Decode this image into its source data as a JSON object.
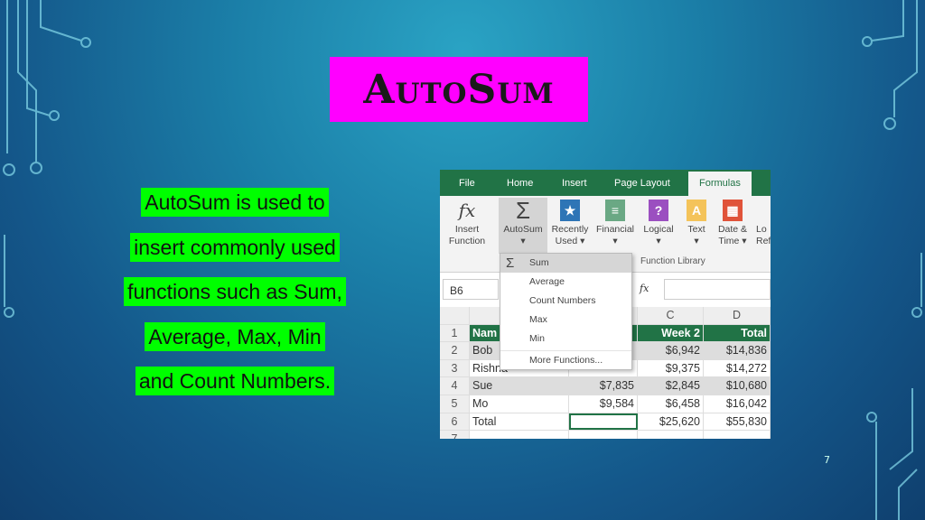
{
  "slide": {
    "title": "AutoSum",
    "page_number": "7",
    "body_lines": [
      "AutoSum is used to",
      "insert commonly used",
      "functions such as Sum,",
      "Average, Max, Min",
      "and Count Numbers."
    ],
    "colors": {
      "title_highlight": "#ff00ff",
      "text_highlight": "#00ff00",
      "excel_green": "#217346"
    }
  },
  "excel": {
    "tabs": [
      "File",
      "Home",
      "Insert",
      "Page Layout",
      "Formulas"
    ],
    "ribbon": [
      {
        "l1": "Insert",
        "l2": "Function",
        "icon": "fx-icon"
      },
      {
        "l1": "AutoSum",
        "l2": "▾",
        "icon": "sigma-icon"
      },
      {
        "l1": "Recently",
        "l2": "Used ▾",
        "icon": "star-book-icon"
      },
      {
        "l1": "Financial",
        "l2": "▾",
        "icon": "financial-icon"
      },
      {
        "l1": "Logical",
        "l2": "▾",
        "icon": "question-icon"
      },
      {
        "l1": "Text",
        "l2": "▾",
        "icon": "text-a-icon"
      },
      {
        "l1": "Date &",
        "l2": "Time ▾",
        "icon": "calendar-icon"
      },
      {
        "l1": "Lo",
        "l2": "Ref",
        "icon": "lookup-icon"
      }
    ],
    "group_label": "Function Library",
    "name_box": "B6",
    "fx": "fx",
    "menu": [
      "Sum",
      "Average",
      "Count Numbers",
      "Max",
      "Min",
      "More Functions..."
    ],
    "col_headers": [
      "",
      "C",
      "D"
    ],
    "rows": [
      {
        "n": "1",
        "a": "Nam",
        "b": "",
        "c": "Week 2",
        "d": "Total"
      },
      {
        "n": "2",
        "a": "Bob",
        "b": "",
        "c": "$6,942",
        "d": "$14,836"
      },
      {
        "n": "3",
        "a": "Rishna",
        "b": "",
        "c": "$9,375",
        "d": "$14,272"
      },
      {
        "n": "4",
        "a": "Sue",
        "b": "$7,835",
        "c": "$2,845",
        "d": "$10,680"
      },
      {
        "n": "5",
        "a": "Mo",
        "b": "$9,584",
        "c": "$6,458",
        "d": "$16,042"
      },
      {
        "n": "6",
        "a": "Total",
        "b": "",
        "c": "$25,620",
        "d": "$55,830"
      },
      {
        "n": "7",
        "a": "",
        "b": "",
        "c": "",
        "d": ""
      }
    ]
  }
}
